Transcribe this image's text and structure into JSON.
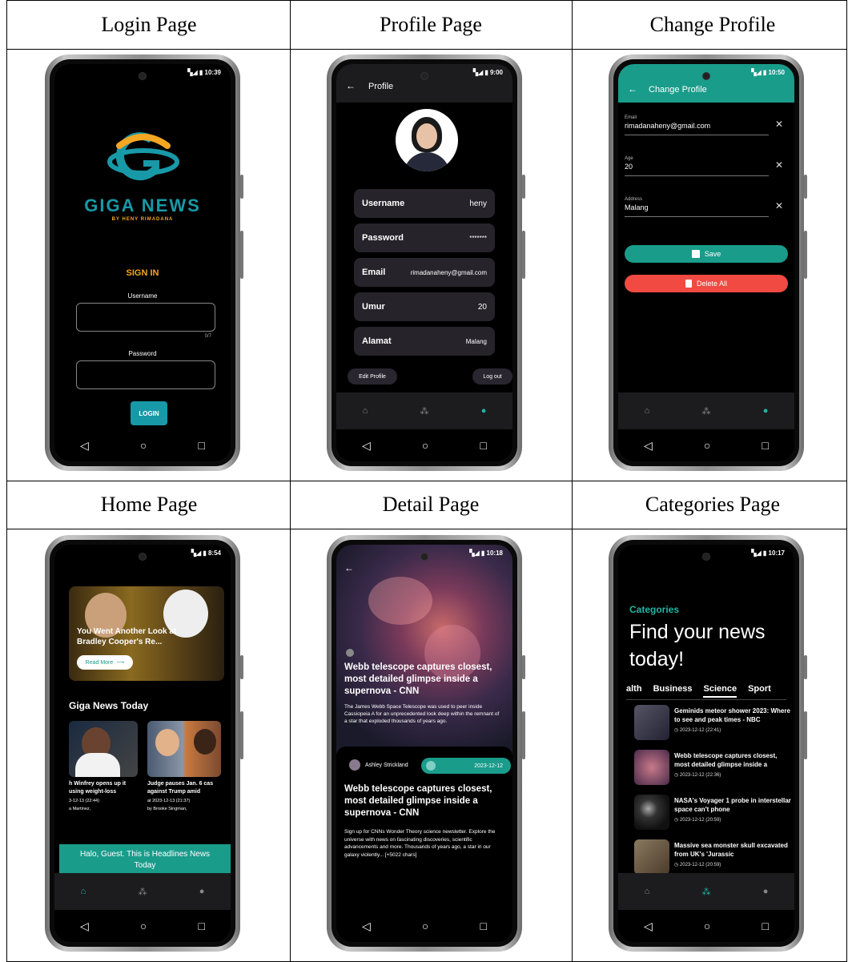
{
  "captions": [
    "Login Page",
    "Profile Page",
    "Change Profile",
    "Home Page",
    "Detail Page",
    "Categories Page"
  ],
  "colors": {
    "accent": "#1fb5a4",
    "orange": "#f5a623",
    "danger": "#f04a43",
    "bar": "#1c1c1e"
  },
  "nav_icons": {
    "back": "back-triangle-icon",
    "home": "home-circle-icon",
    "recents": "recents-square-icon"
  },
  "login": {
    "time": "10:39",
    "logo_title": "GIGA NEWS",
    "logo_sub": "BY HENY RIMADANA",
    "heading": "SIGN IN",
    "username_label": "Username",
    "counter": "0/7",
    "password_label": "Password",
    "login_button": "LOGIN"
  },
  "profile": {
    "time": "9:00",
    "title": "Profile",
    "rows": [
      {
        "label": "Username",
        "value": "heny"
      },
      {
        "label": "Password",
        "value": "*******"
      },
      {
        "label": "Email",
        "value": "rimadanaheny@gmail.com"
      },
      {
        "label": "Umur",
        "value": "20"
      },
      {
        "label": "Alamat",
        "value": "Malang"
      }
    ],
    "edit_button": "Edit Profile",
    "logout_button": "Log out"
  },
  "change": {
    "time": "10:50",
    "title": "Change Profile",
    "fields": [
      {
        "label": "Email",
        "value": "rimadanaheny@gmail.com"
      },
      {
        "label": "Age",
        "value": "20"
      },
      {
        "label": "Address",
        "value": "Malang"
      }
    ],
    "save_button": "Save",
    "delete_button": "Delete All"
  },
  "home": {
    "time": "8:54",
    "hero_title": "You Went Another Look at Bradley Cooper's Re...",
    "read_more": "Read More",
    "section_title": "Giga News Today",
    "cards": [
      {
        "title": "h Winfrey opens up it using weight-loss",
        "date": "3-12-13 (22:44)",
        "author": "a Martinez,"
      },
      {
        "title": "Judge pauses Jan. 6 cas against Trump amid",
        "date": "at 2023-12-13 (21:37)",
        "author": "by Brooke Singman,"
      }
    ],
    "toast": "Halo, Guest. This is Headlines News Today"
  },
  "detail": {
    "time": "10:18",
    "hero_title": "Webb telescope captures closest, most detailed glimpse inside a supernova - CNN",
    "hero_desc": "The James Webb Space Telescope was used to peer inside Cassiopeia A for an unprecedented look deep within the remnant of a star that exploded thousands of years ago.",
    "author": "Ashley Strickland",
    "date": "2023-12-12",
    "title": "Webb telescope captures closest, most detailed glimpse inside a supernova - CNN",
    "body": "Sign up for CNNs Wonder Theory science newsletter. Explore the universe with news on fascinating discoveries, scientific advancements and more. Thousands of years ago, a star in our galaxy violently... [+5022 chars]"
  },
  "categories": {
    "time": "10:17",
    "label": "Categories",
    "headline": "Find your news today!",
    "tabs": [
      "alth",
      "Business",
      "Science",
      "Sport"
    ],
    "active_tab": "Science",
    "items": [
      {
        "title": "Geminids meteor shower 2023: Where to see and peak times - NBC",
        "date": "2023-12-12 (22:41)"
      },
      {
        "title": "Webb telescope captures closest, most detailed glimpse inside a",
        "date": "2023-12-12 (22:36)"
      },
      {
        "title": "NASA's Voyager 1 probe in interstellar space can't phone",
        "date": "2023-12-12 (20:59)"
      },
      {
        "title": "Massive sea monster skull excavated from UK's 'Jurassic",
        "date": "2023-12-12 (20:59)"
      }
    ]
  }
}
